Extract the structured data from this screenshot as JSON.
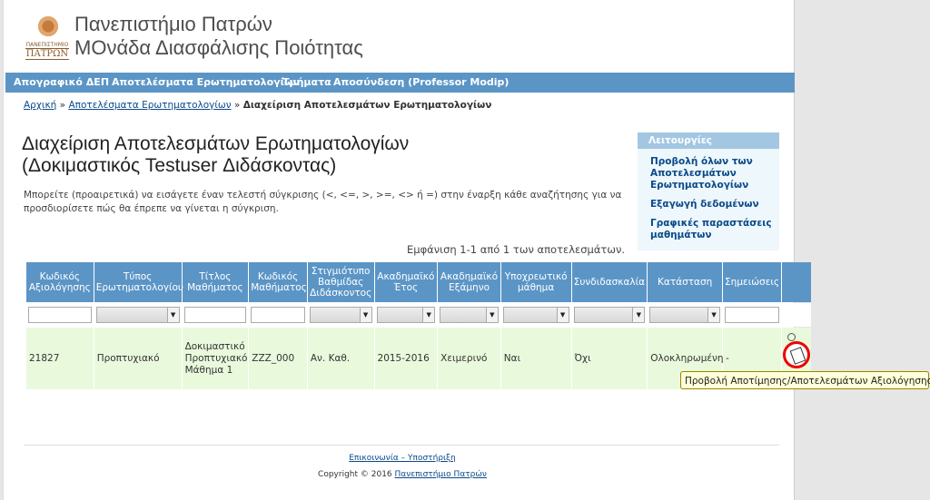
{
  "header": {
    "logo_text_small": "ΠΑΝΕΠΙΣΤΗΜΙΟ",
    "logo_text_big": "ΠΑΤΡΩΝ",
    "title_line1": "Πανεπιστήμιο Πατρών",
    "title_line2": "ΜΟνάδα Διασφάλισης Ποιότητας"
  },
  "nav": {
    "items": [
      {
        "label": "Απογραφικό ΔΕΠ"
      },
      {
        "label": "Αποτελέσματα Ερωτηματολογίων"
      },
      {
        "label": "Τμήματα"
      },
      {
        "label": "Αποσύνδεση (Professor Modip)"
      }
    ]
  },
  "breadcrumb": {
    "home": "Αρχική",
    "sep": "»",
    "results": "Αποτελέσματα Ερωτηματολογίων",
    "current": "Διαχείριση Αποτελεσμάτων Ερωτηματολογίων"
  },
  "main": {
    "title_line1": "Διαχείριση Αποτελεσμάτων Ερωτηματολογίων",
    "title_line2": "(Δοκιμαστικός Testuser Διδάσκοντας)",
    "intro": "Μπορείτε (προαιρετικά) να εισάγετε έναν τελεστή σύγκρισης (<, <=, >, >=, <> ή =) στην έναρξη κάθε αναζήτησης για να προσδιορίσετε πώς θα έπρεπε να γίνεται η σύγκριση.",
    "summary": "Εμφάνιση 1-1 από 1 των αποτελεσμάτων."
  },
  "sidebar": {
    "heading": "Λειτουργίες",
    "items": [
      {
        "label": "Προβολή όλων των Αποτελεσμάτων Ερωτηματολογίων"
      },
      {
        "label": "Εξαγωγή δεδομένων"
      },
      {
        "label": "Γραφικές παραστάσεις μαθημάτων"
      }
    ]
  },
  "table": {
    "headers": [
      "Κωδικός Αξιολόγησης",
      "Τύπος Ερωτηματολογίου",
      "Τίτλος Μαθήματος",
      "Κωδικός Μαθήματος",
      "Στιγμιότυπο Βαθμίδας Διδάσκοντος",
      "Ακαδημαϊκό Έτος",
      "Ακαδημαϊκό Εξάμηνο",
      "Υποχρεωτικό μάθημα",
      "Συνδιδασκαλία",
      "Κατάσταση",
      "Σημειώσεις",
      ""
    ],
    "filter_select_arrow": "▼",
    "row": [
      "21827",
      "Προπτυχιακό",
      "Δοκιμαστικό Προπτυχιακό Μάθημα 1",
      "ZZZ_000",
      "Αν. Καθ.",
      "2015-2016",
      "Χειμερινό",
      "Ναι",
      "Όχι",
      "Ολοκληρωμένη",
      "-"
    ]
  },
  "tooltip": "Προβολή Αποτίμησης/Αποτελεσμάτων Αξιολόγησης",
  "footer": {
    "contact": "Επικοινωνία – Υποστήριξη",
    "copyright": "Copyright © 2016",
    "university": "Πανεπιστήμιο Πατρών"
  },
  "colors": {
    "nav_bg": "#5b95c6",
    "row_bg": "#e9fadc",
    "highlight_ring": "#e00000"
  }
}
